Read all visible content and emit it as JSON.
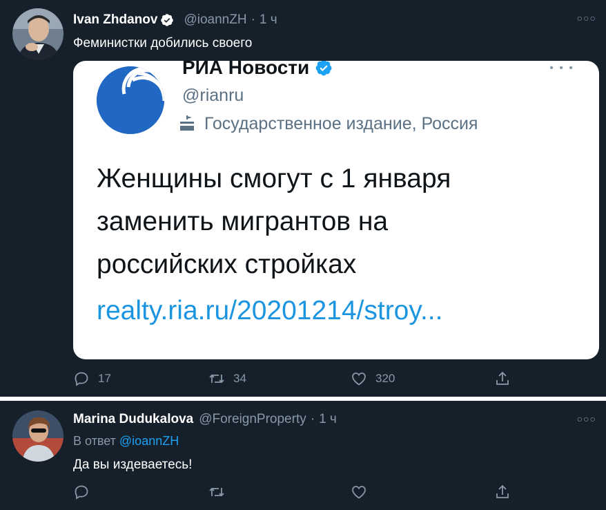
{
  "tweets": [
    {
      "author": "Ivan Zhdanov",
      "handle": "@ioannZH",
      "time": "1 ч",
      "text": "Феминистки добились своего",
      "verified": true,
      "embed": {
        "account_name": "РИА Новости",
        "account_handle": "@rianru",
        "account_label": "Государственное издание, Россия",
        "body_lines": [
          "Женщины смогут с 1 января",
          "заменить мигрантов на",
          "российских стройках"
        ],
        "link": "realty.ria.ru/20201214/stroy..."
      },
      "actions": {
        "replies": "17",
        "retweets": "34",
        "likes": "320"
      }
    },
    {
      "author": "Marina Dudukalova",
      "handle": "@ForeignProperty",
      "time": "1 ч",
      "reply_prefix": "В ответ",
      "reply_to": "@ioannZH",
      "text": "Да вы издеваетесь!"
    }
  ],
  "colors": {
    "background": "#15202b",
    "accent": "#1da1f2",
    "muted": "#8899a6",
    "card_background": "#ffffff"
  },
  "icons": [
    "verified-badge-icon",
    "more-icon",
    "reply-icon",
    "retweet-icon",
    "like-icon",
    "share-icon",
    "government-label-icon"
  ]
}
